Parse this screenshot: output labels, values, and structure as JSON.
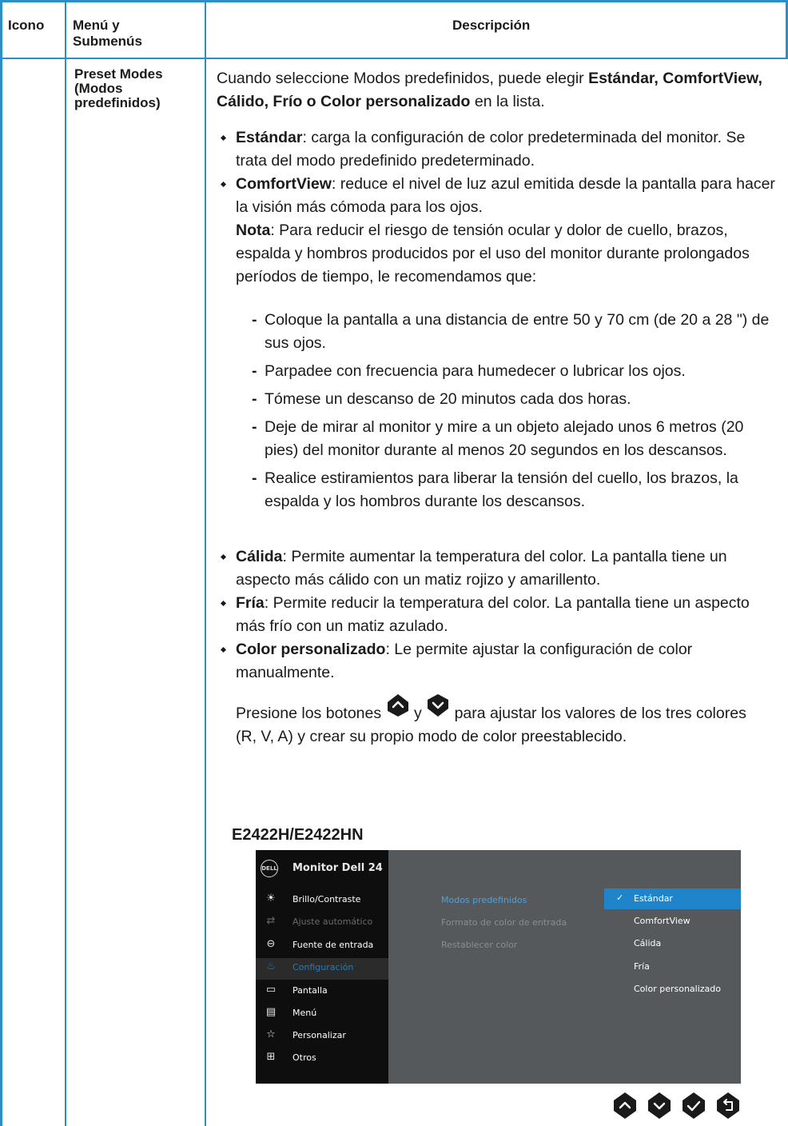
{
  "header": {
    "icon": "Icono",
    "menu_line1": "Menú y",
    "menu_line2": "Submenús",
    "description": "Descripción"
  },
  "menu": {
    "line1": "Preset Modes",
    "line2": "(Modos",
    "line3": "predefinidos)"
  },
  "intro": {
    "prefix": "Cuando seleccione Modos predefinidos, puede elegir ",
    "bold": "Estándar, ComfortView, Cálido, Frío o Color personalizado",
    "suffix": " en la lista."
  },
  "bullets_top": [
    {
      "term": "Estándar",
      "text": ": carga la configuración de color predeterminada del monitor. Se trata del modo predefinido predeterminado."
    },
    {
      "term": "ComfortView",
      "text": ": reduce el nivel de luz azul emitida desde la pantalla para hacer la visión más cómoda para los ojos."
    }
  ],
  "note": {
    "term": "Nota",
    "text": ": Para reducir el riesgo de tensión ocular y dolor de cuello, brazos, espalda y hombros producidos por el uso del monitor durante prolongados períodos de tiempo, le recomendamos que:"
  },
  "tips": [
    "Coloque la pantalla a una distancia de entre 50 y 70 cm (de 20 a 28 \") de sus ojos.",
    "Parpadee con frecuencia para humedecer o lubricar los ojos.",
    "Tómese un descanso de 20 minutos cada dos horas.",
    "Deje de mirar al monitor y mire a un objeto alejado unos 6 metros (20 pies) del monitor durante al menos 20 segundos en los descansos.",
    "Realice estiramientos para liberar la tensión del cuello, los brazos, la espalda y los hombros durante los descansos."
  ],
  "bullets_bottom": [
    {
      "term": "Cálida",
      "text": ": Permite aumentar la temperatura del color. La pantalla tiene un aspecto más cálido con un matiz rojizo y amarillento."
    },
    {
      "term": "Fría",
      "text": ": Permite reducir la temperatura del color. La pantalla tiene un aspecto más frío con un matiz azulado."
    },
    {
      "term": "Color personalizado",
      "text": ": Le permite ajustar la configuración de color manualmente."
    }
  ],
  "press": {
    "a": "Presione los botones",
    "y": "y",
    "b": "para ajustar los valores de los tres colores",
    "line2": "(R, V, A) y crear su propio modo de color preestablecido."
  },
  "model": "E2422H/E2422HN",
  "osd": {
    "logo": "DELL",
    "title": "Monitor Dell 24",
    "menu": [
      {
        "label": "Brillo/Contraste",
        "icon": "brightness-icon",
        "state": "normal"
      },
      {
        "label": "Ajuste automático",
        "icon": "auto-adjust-icon",
        "state": "dim"
      },
      {
        "label": "Fuente de entrada",
        "icon": "input-source-icon",
        "state": "normal"
      },
      {
        "label": "Configuración",
        "icon": "color-icon",
        "state": "selected"
      },
      {
        "label": "Pantalla",
        "icon": "display-icon",
        "state": "normal"
      },
      {
        "label": "Menú",
        "icon": "menu-icon",
        "state": "normal"
      },
      {
        "label": "Personalizar",
        "icon": "star-icon",
        "state": "normal"
      },
      {
        "label": "Otros",
        "icon": "others-icon",
        "state": "normal"
      }
    ],
    "submenu": [
      {
        "label": "Modos predefinidos",
        "active": true
      },
      {
        "label": "Formato de color de entrada",
        "active": false
      },
      {
        "label": "Restablecer color",
        "active": false
      }
    ],
    "options": [
      {
        "label": "Estándar",
        "selected": true
      },
      {
        "label": "ComfortView",
        "selected": false
      },
      {
        "label": "Cálida",
        "selected": false
      },
      {
        "label": "Fría",
        "selected": false
      },
      {
        "label": "Color personalizado",
        "selected": false
      }
    ],
    "buttons": [
      "up-icon",
      "down-icon",
      "check-icon",
      "back-icon"
    ]
  },
  "colors": {
    "table_border": "#2a8fc9",
    "osd_accent": "#1f84c9",
    "osd_background": "#55595c",
    "osd_sidebar": "#0e0e0e"
  }
}
